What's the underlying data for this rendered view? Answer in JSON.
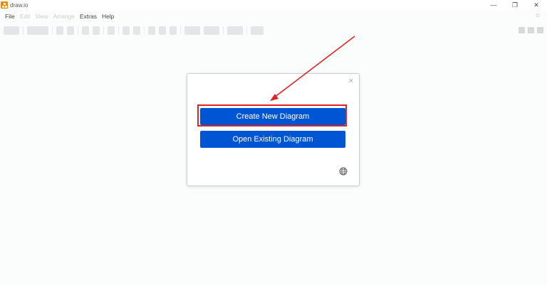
{
  "window": {
    "title": "draw.io",
    "controls": {
      "minimize": "—",
      "maximize": "❐",
      "close": "✕"
    }
  },
  "menu": {
    "items": [
      {
        "label": "File",
        "enabled": true
      },
      {
        "label": "Edit",
        "enabled": false
      },
      {
        "label": "View",
        "enabled": false
      },
      {
        "label": "Arrange",
        "enabled": false
      },
      {
        "label": "Extras",
        "enabled": true
      },
      {
        "label": "Help",
        "enabled": true
      }
    ],
    "theme_icon": "sun-icon"
  },
  "dialog": {
    "close_glyph": "×",
    "create_label": "Create New Diagram",
    "open_label": "Open Existing Diagram",
    "language_icon": "globe-icon"
  },
  "colors": {
    "primary_button": "#0055d4",
    "highlight": "#e02424",
    "app_logo": "#f08705"
  }
}
